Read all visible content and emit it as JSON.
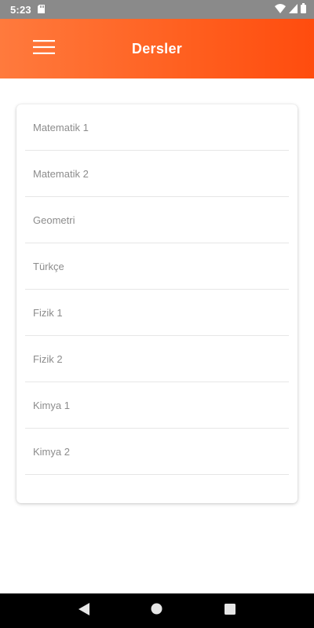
{
  "status_bar": {
    "time": "5:23",
    "icons": [
      "sd-card-icon",
      "wifi-icon",
      "signal-icon",
      "battery-icon"
    ]
  },
  "app_bar": {
    "title": "Dersler",
    "menu_icon": "hamburger-menu-icon",
    "gradient_start": "#ff7a3d",
    "gradient_end": "#ff4c0e"
  },
  "courses": [
    {
      "label": "Matematik 1"
    },
    {
      "label": "Matematik 2"
    },
    {
      "label": "Geometri"
    },
    {
      "label": "Türkçe"
    },
    {
      "label": "Fizik 1"
    },
    {
      "label": "Fizik 2"
    },
    {
      "label": "Kimya 1"
    },
    {
      "label": "Kimya 2"
    }
  ],
  "nav_bar": {
    "buttons": [
      "back-icon",
      "home-icon",
      "recents-icon"
    ]
  },
  "colors": {
    "accent": "#ff5f1f",
    "item_text": "#8c8c8c",
    "status_bar": "#8a8a8a"
  }
}
